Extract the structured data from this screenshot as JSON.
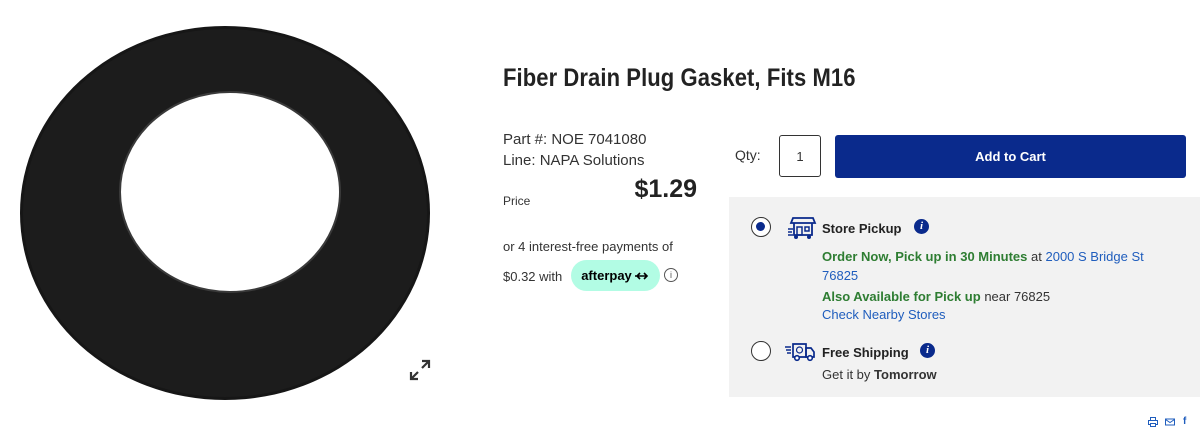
{
  "product": {
    "title": "Fiber Drain Plug Gasket, Fits M16",
    "part_number": "Part #: NOE 7041080",
    "line": "Line: NAPA Solutions",
    "price_label": "Price",
    "price": "$1.29",
    "image_icon": "expand-icon"
  },
  "afterpay": {
    "text": "or 4 interest-free payments of",
    "amount_prefix": "$0.32 with",
    "badge": "afterpay",
    "info_icon": "ⓘ"
  },
  "cart": {
    "qty_label": "Qty:",
    "qty_value": "1",
    "add_to_cart": "Add to Cart"
  },
  "fulfillment": {
    "store_pickup": {
      "title": "Store Pickup",
      "selected": true,
      "order_now": "Order Now, Pick up in 30 Minutes",
      "at": " at ",
      "address": "2000 S Bridge St",
      "zip": "76825",
      "also_available": "Also Available for Pick up",
      "near": " near 76825",
      "check_stores": "Check Nearby Stores"
    },
    "free_shipping": {
      "title": "Free Shipping",
      "selected": false,
      "get_it_by": "Get it by ",
      "when": "Tomorrow"
    }
  },
  "colors": {
    "brand_blue": "#0a2a8c",
    "green": "#2e7d32",
    "link": "#1f5dbd",
    "afterpay_mint": "#b2fce4",
    "panel_bg": "#f2f2f2"
  },
  "share": {
    "icons": [
      "print-icon",
      "mail-icon",
      "facebook-icon"
    ],
    "facebook": "f"
  }
}
